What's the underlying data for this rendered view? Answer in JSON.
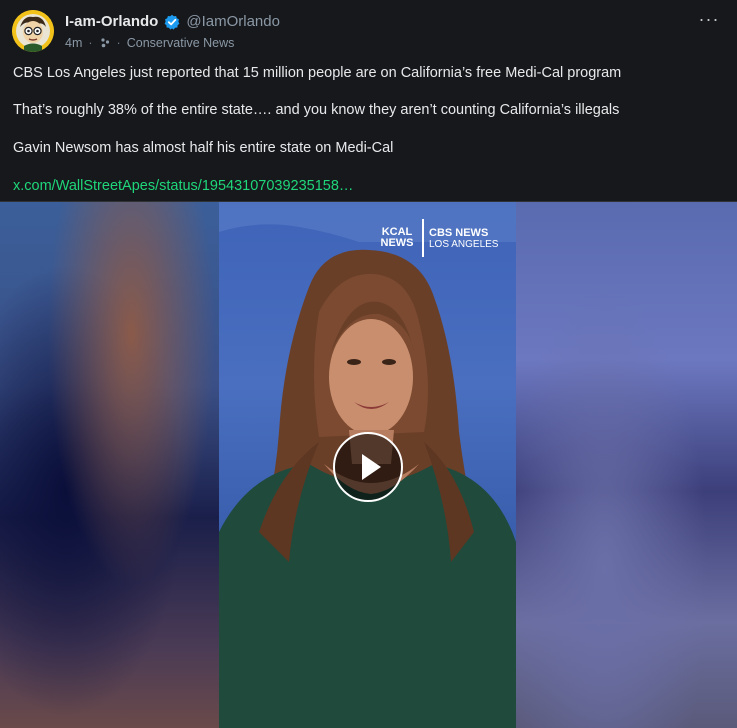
{
  "post": {
    "author": {
      "display_name": "I-am-Orlando",
      "handle": "@IamOrlando",
      "verified_icon": "verified-badge-icon",
      "avatar_icon": "cartoon-avatar-icon"
    },
    "meta": {
      "time_ago": "4m",
      "separator": "·",
      "community": "Conservative News"
    },
    "more_label": "···",
    "body": {
      "line1": "CBS Los Angeles just reported that 15 million people are on California’s free Medi-Cal program",
      "line2": "That’s roughly 38% of the entire state…. and you know they aren’t counting California’s illegals",
      "line3": "Gavin Newsom has almost half his entire state on Medi-Cal",
      "link": "x.com/WallStreetApes/status/19543107039235158…"
    },
    "media": {
      "logo_left_1": "KCAL",
      "logo_left_2": "NEWS",
      "logo_right_1": "CBS NEWS",
      "logo_right_2": "LOS ANGELES",
      "play_icon": "play-icon"
    }
  },
  "colors": {
    "background": "#16181c",
    "link": "#1fd67a",
    "muted": "#8b98a5",
    "verified": "#1d9bf0"
  }
}
